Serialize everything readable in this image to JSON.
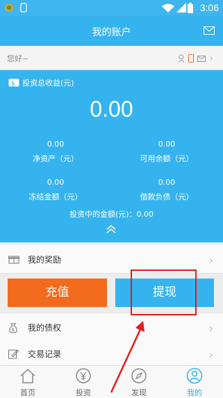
{
  "statusbar": {
    "time": "3:06"
  },
  "header": {
    "title": "我的账户"
  },
  "greeting": {
    "text": "您好~"
  },
  "summary": {
    "total_label": "投资总收益(元)",
    "total_value": "0.00",
    "cells": [
      {
        "value": "0.00",
        "label": "净资产（元）"
      },
      {
        "value": "0.00",
        "label": "可用余额（元）"
      },
      {
        "value": "0.00",
        "label": "冻结金额（元）"
      },
      {
        "value": "0.00",
        "label": "借款负债（元）"
      }
    ],
    "investing": "投资中的金额(元)：0.00"
  },
  "menu": {
    "rewards": "我的奖励",
    "creditor": "我的债权",
    "transactions": "交易记录"
  },
  "actions": {
    "recharge": "充值",
    "withdraw": "提现"
  },
  "tabs": [
    {
      "label": "首页",
      "icon": "home-icon"
    },
    {
      "label": "投资",
      "icon": "yen-icon"
    },
    {
      "label": "发现",
      "icon": "compass-icon"
    },
    {
      "label": "我的",
      "icon": "user-icon"
    }
  ],
  "colors": {
    "primary": "#35b3ee",
    "recharge": "#f26b1d",
    "annotation": "#e41b1b"
  }
}
